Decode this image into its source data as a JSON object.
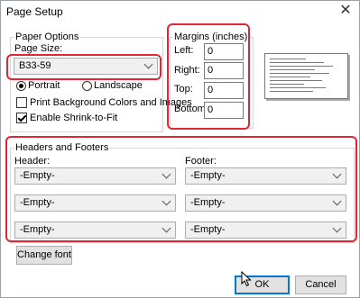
{
  "window": {
    "title": "Page Setup",
    "close_glyph": "✕"
  },
  "paper_options": {
    "group_label": "Paper Options",
    "page_size_label": "Page Size:",
    "page_size_value": "B33-59",
    "portrait_label": "Portrait",
    "landscape_label": "Landscape",
    "orientation_selected": "Portrait",
    "print_background_label": "Print Background Colors and Images",
    "print_background_checked": false,
    "shrink_label": "Enable Shrink-to-Fit",
    "shrink_checked": true
  },
  "margins": {
    "group_label": "Margins (inches)",
    "left_label": "Left:",
    "left_value": "0",
    "right_label": "Right:",
    "right_value": "0",
    "top_label": "Top:",
    "top_value": "0",
    "bottom_label": "Bottom:",
    "bottom_value": "0"
  },
  "headers_footers": {
    "group_label": "Headers and Footers",
    "header_label": "Header:",
    "footer_label": "Footer:",
    "header_values": [
      "-Empty-",
      "-Empty-",
      "-Empty-"
    ],
    "footer_values": [
      "-Empty-",
      "-Empty-",
      "-Empty-"
    ]
  },
  "buttons": {
    "change_font": "Change font",
    "ok": "OK",
    "cancel": "Cancel"
  },
  "colors": {
    "highlight": "#e32636",
    "focus": "#0078d7"
  },
  "icons": {
    "close": "close-icon",
    "dropdown": "chevron-down-icon",
    "cursor": "mouse-pointer-icon"
  }
}
